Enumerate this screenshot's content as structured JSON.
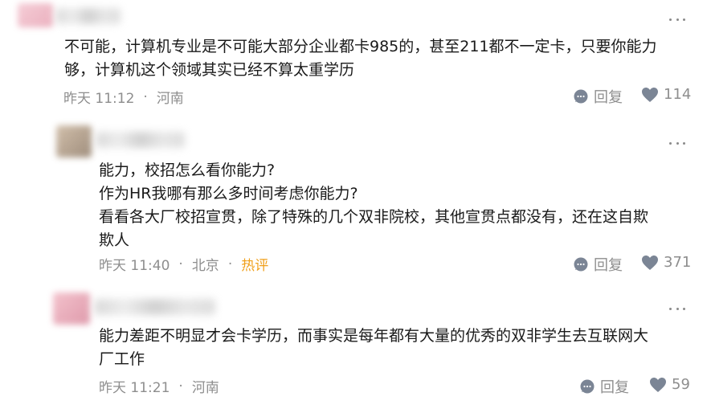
{
  "colors": {
    "hot": "#f0a01c",
    "meta": "#8e8e8e",
    "icon": "#7b8595"
  },
  "comments": [
    {
      "lines": [
        "不可能，计算机专业是不可能大部分企业都卡985的，甚至211都不一定卡，只要你能力",
        "够，计算机这个领域其实已经不算太重学历"
      ],
      "time": "昨天 11:12",
      "location": "河南",
      "reply_label": "回复",
      "likes": "114"
    },
    {
      "lines": [
        "能力，校招怎么看你能力?",
        "作为HR我哪有那么多时间考虑你能力?",
        "看看各大厂校招宣贯，除了特殊的几个双非院校，其他宣贯点都没有，还在这自欺",
        "欺人"
      ],
      "time": "昨天 11:40",
      "location": "北京",
      "badge": "热评",
      "reply_label": "回复",
      "likes": "371"
    },
    {
      "lines": [
        "能力差距不明显才会卡学历，而事实是每年都有大量的优秀的双非学生去互联网大",
        "厂工作"
      ],
      "time": "昨天 11:21",
      "location": "河南",
      "reply_label": "回复",
      "likes": "59"
    }
  ]
}
